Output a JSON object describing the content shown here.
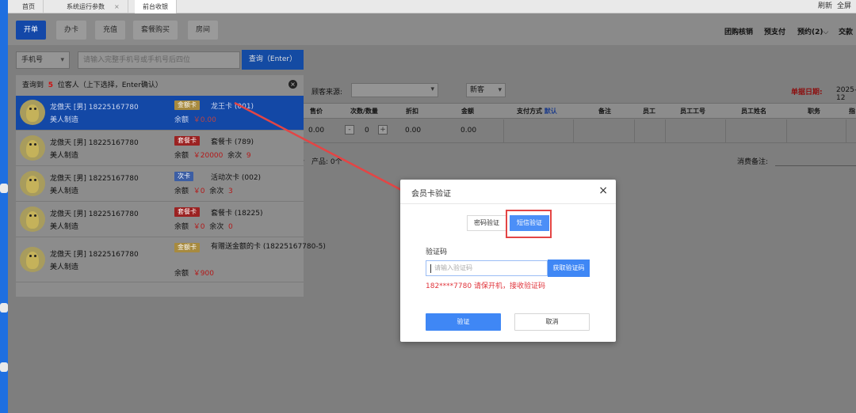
{
  "tabs": [
    {
      "label": "首页"
    },
    {
      "label": "系统运行参数",
      "close": "×"
    },
    {
      "label": "前台收银"
    }
  ],
  "top_right": [
    "刷新",
    "全屏"
  ],
  "toolbar": {
    "buttons": [
      "开单",
      "办卡",
      "充值",
      "套餐购买",
      "房间"
    ],
    "right_links": [
      "团购核销",
      "预支付",
      "预约(2)",
      "交款"
    ],
    "dropdown_chevron": "⌵"
  },
  "search": {
    "type": "手机号",
    "placeholder": "请输入完整手机号或手机号后四位",
    "button": "查询（Enter）"
  },
  "results": {
    "prefix": "查询到",
    "count": "5",
    "suffix": "位客人（上下选择，Enter确认）",
    "close": "×",
    "rows": [
      {
        "name": "龙傲天 [男] 18225167780",
        "shop": "美人制造",
        "badge": "金额卡",
        "card": "龙王卡 (001)",
        "bal_label": "余额",
        "bal": "￥0.00",
        "times_label": "",
        "times": ""
      },
      {
        "name": "龙傲天 [男] 18225167780",
        "shop": "美人制造",
        "badge": "套餐卡",
        "card": "套餐卡 (789)",
        "bal_label": "余额",
        "bal": "￥20000",
        "times_label": "余次",
        "times": "9"
      },
      {
        "name": "龙傲天 [男] 18225167780",
        "shop": "美人制造",
        "badge": "次卡",
        "card": "活动次卡 (002)",
        "bal_label": "余额",
        "bal": "￥0",
        "times_label": "余次",
        "times": "3"
      },
      {
        "name": "龙傲天 [男] 18225167780",
        "shop": "美人制造",
        "badge": "套餐卡",
        "card": "套餐卡 (18225)",
        "bal_label": "余额",
        "bal": "￥0",
        "times_label": "余次",
        "times": "0"
      },
      {
        "name": "龙傲天 [男] 18225167780",
        "shop": "美人制造",
        "badge": "金额卡",
        "card": "有赠送金额的卡 (18225167780-5)",
        "bal_label": "余额",
        "bal": "￥900",
        "times_label": "",
        "times": ""
      }
    ]
  },
  "order": {
    "source_label": "顾客来源:",
    "customer_type": "新客",
    "date_label": "单据日期:",
    "date_value": "2025-12",
    "headers": [
      "售价",
      "次数/数量",
      "折扣",
      "金额",
      "支付方式",
      "默认",
      "备注",
      "员工",
      "员工工号",
      "员工姓名",
      "职务",
      "指"
    ],
    "row": {
      "price": "0.00",
      "qty": "0",
      "discount": "0.00",
      "amount": "0.00",
      "minus": "-",
      "plus": "+"
    },
    "summary": "个　产品: 0个",
    "note_label": "消费备注:"
  },
  "modal": {
    "title": "会员卡验证",
    "close": "×",
    "tab_password": "密码验证",
    "tab_sms": "短信验证",
    "code_label": "验证码",
    "code_placeholder": "请输入验证码",
    "get_code": "获取验证码",
    "hint": "182****7780 请保开机，接收验证码",
    "verify": "验证",
    "cancel": "取消"
  },
  "colors": {
    "primary": "#3f87f5",
    "accent_red": "#e34545",
    "toolbar_active": "#1448a8"
  }
}
